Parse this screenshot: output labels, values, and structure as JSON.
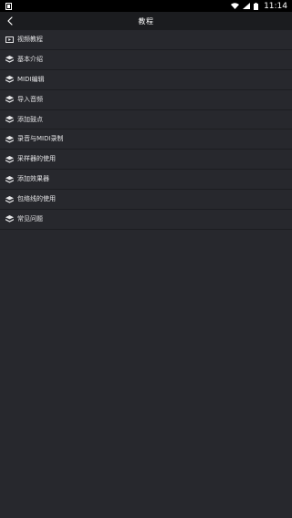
{
  "status_bar": {
    "time": "11:14"
  },
  "header": {
    "title": "教程"
  },
  "menu": [
    {
      "label": "视频教程",
      "icon": "video-icon"
    },
    {
      "label": "基本介绍",
      "icon": "layers-icon"
    },
    {
      "label": "MIDI编辑",
      "icon": "layers-icon"
    },
    {
      "label": "导入音频",
      "icon": "layers-icon"
    },
    {
      "label": "添加鼓点",
      "icon": "layers-icon"
    },
    {
      "label": "录音与MIDI录制",
      "icon": "layers-icon"
    },
    {
      "label": "采样器的使用",
      "icon": "layers-icon"
    },
    {
      "label": "添加效果器",
      "icon": "layers-icon"
    },
    {
      "label": "包络线的使用",
      "icon": "layers-icon"
    },
    {
      "label": "常见问题",
      "icon": "layers-icon"
    }
  ],
  "colors": {
    "background": "#27282d",
    "header": "#1b1c1f",
    "status_bar": "#000000",
    "text": "#e4e4e6"
  }
}
